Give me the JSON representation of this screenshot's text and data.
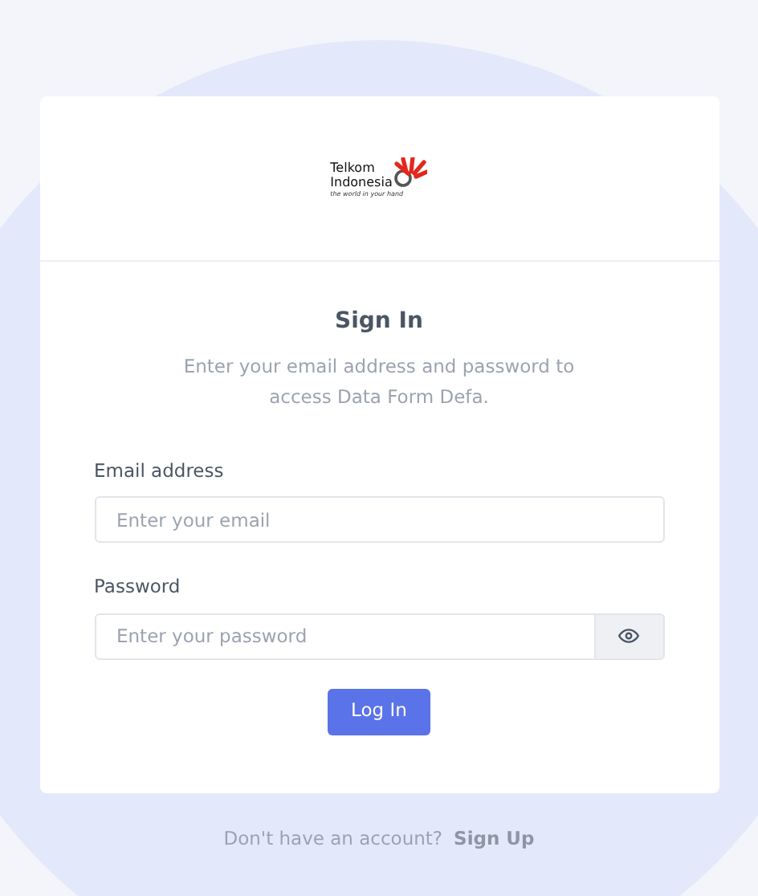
{
  "logo": {
    "line_1": "Telkom",
    "line_2": "Indonesia",
    "tagline": "the world in your hand"
  },
  "heading": "Sign In",
  "subtitle": "Enter your email address and password to access Data Form Defa.",
  "fields": [
    {
      "kind": "email",
      "label": "Email address",
      "placeholder": "Enter your email"
    },
    {
      "kind": "password",
      "label": "Password",
      "placeholder": "Enter your password"
    }
  ],
  "submit": "Log In",
  "footer": {
    "text": "Don't have an account?",
    "link": "Sign Up"
  }
}
